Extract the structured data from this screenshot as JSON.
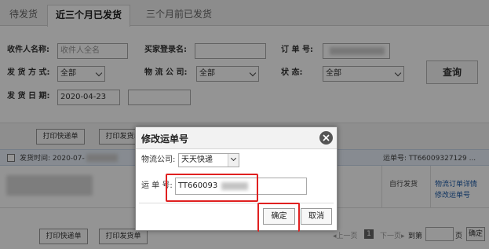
{
  "tabs": [
    {
      "label": "待发货",
      "active": false
    },
    {
      "label": "近三个月已发货",
      "active": true
    },
    {
      "label": "三个月前已发货",
      "active": false
    }
  ],
  "search": {
    "receiver_label": "收件人名称:",
    "receiver_placeholder": "收件人全名",
    "buyer_label": "买家登录名:",
    "order_label": "订 单 号:",
    "ship_method_label": "发 货 方 式:",
    "ship_method_value": "全部",
    "logistics_label": "物 流 公 司:",
    "logistics_value": "全部",
    "status_label": "状   态:",
    "status_value": "全部",
    "date_label": "发 货 日 期:",
    "date_value": "2020-04-23",
    "query_label": "查询"
  },
  "toolbar": {
    "print_express": "打印快递单",
    "print_ship": "打印发货单"
  },
  "order": {
    "ship_time_label": "发货时间: 2020-07-",
    "tracking_label": "运单号: TT66009327129 ...",
    "mode": "自行发货",
    "detail_link": "物流订单详情",
    "modify_link": "修改运单号"
  },
  "footer": {
    "print_express": "打印快递单",
    "print_ship": "打印发货单",
    "prev": "◂上一页",
    "page": "1",
    "next": "下一页▸",
    "goto": "到第",
    "page_unit": "页",
    "confirm": "确定"
  },
  "dialog": {
    "title": "修改运单号",
    "company_label": "物流公司:",
    "company_value": "天天快递",
    "tracking_label": "运 单 号:",
    "tracking_value": "TT660093",
    "confirm_label": "确定",
    "cancel_label": "取消"
  },
  "colors": {
    "overlay": "#000000",
    "highlight": "#e02020",
    "link": "#1b5aa8"
  }
}
